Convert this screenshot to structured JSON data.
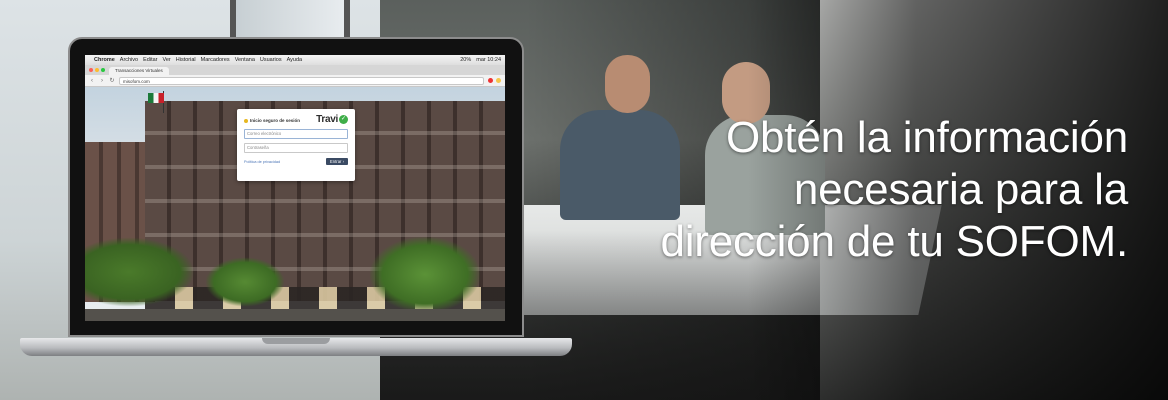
{
  "banner": {
    "headline": [
      "Obtén la información",
      "necesaria para la",
      "dirección de tu SOFOM."
    ]
  },
  "browser": {
    "menubar": {
      "app": "Chrome",
      "items": [
        "Archivo",
        "Editar",
        "Ver",
        "Historial",
        "Marcadores",
        "Ventana",
        "Usuarios",
        "Ayuda"
      ],
      "status": "mar 10:24",
      "battery": "20%"
    },
    "tab_title": "Transacciones Virtuales",
    "url": "misofom.com"
  },
  "login": {
    "title": "Inicio seguro de sesión",
    "brand": "Travi",
    "email_placeholder": "Correo electrónico",
    "password_placeholder": "Contraseña",
    "privacy_link": "Política de privacidad",
    "submit_label": "Entrar",
    "colors": {
      "brand_check": "#3fae49",
      "button": "#3a4a63",
      "link": "#4a74b6"
    }
  },
  "icons": {
    "apple": "apple-icon",
    "check": "check-circle-icon",
    "lock": "lock-icon",
    "back": "chevron-left-icon",
    "forward": "chevron-right-icon",
    "reload": "reload-icon",
    "enter_arrow": "arrow-right-icon"
  }
}
